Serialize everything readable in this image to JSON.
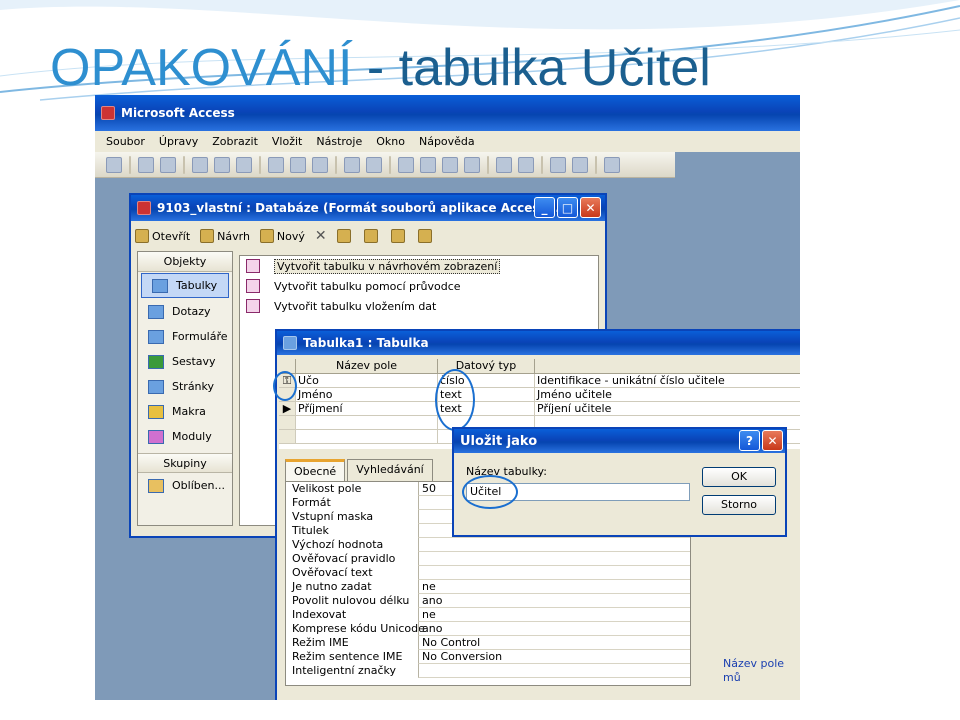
{
  "slide": {
    "title_part1": "OPAKOVÁNÍ",
    "title_part2": " - tabulka Učitel"
  },
  "access": {
    "title": "Microsoft Access",
    "menu": [
      "Soubor",
      "Úpravy",
      "Zobrazit",
      "Vložit",
      "Nástroje",
      "Okno",
      "Nápověda"
    ]
  },
  "db_window": {
    "title": "9103_vlastní : Databáze (Formát souborů aplikace Access ...",
    "toolbar": [
      "Otevřít",
      "Návrh",
      "Nový"
    ],
    "objects_header": "Objekty",
    "objects": [
      "Tabulky",
      "Dotazy",
      "Formuláře",
      "Sestavy",
      "Stránky",
      "Makra",
      "Moduly"
    ],
    "groups_header": "Skupiny",
    "groups": [
      "Oblíben..."
    ],
    "list": [
      "Vytvořit tabulku v návrhovém zobrazení",
      "Vytvořit tabulku pomocí průvodce",
      "Vytvořit tabulku vložením dat"
    ]
  },
  "table_window": {
    "title": "Tabulka1 : Tabulka",
    "columns": [
      "Název pole",
      "Datový typ"
    ],
    "rows": [
      {
        "name": "Učo",
        "type": "číslo",
        "desc": "Identifikace - unikátní číslo učitele"
      },
      {
        "name": "Jméno",
        "type": "text",
        "desc": "Jméno učitele"
      },
      {
        "name": "Příjmení",
        "type": "text",
        "desc": "Příjení učitele"
      }
    ],
    "tabs": [
      "Obecné",
      "Vyhledávání"
    ],
    "properties": [
      {
        "label": "Velikost pole",
        "value": "50"
      },
      {
        "label": "Formát",
        "value": ""
      },
      {
        "label": "Vstupní maska",
        "value": ""
      },
      {
        "label": "Titulek",
        "value": ""
      },
      {
        "label": "Výchozí hodnota",
        "value": ""
      },
      {
        "label": "Ověřovací pravidlo",
        "value": ""
      },
      {
        "label": "Ověřovací text",
        "value": ""
      },
      {
        "label": "Je nutno zadat",
        "value": "ne"
      },
      {
        "label": "Povolit nulovou délku",
        "value": "ano"
      },
      {
        "label": "Indexovat",
        "value": "ne"
      },
      {
        "label": "Komprese kódu Unicode",
        "value": "ano"
      },
      {
        "label": "Režim IME",
        "value": "No Control"
      },
      {
        "label": "Režim sentence IME",
        "value": "No Conversion"
      },
      {
        "label": "Inteligentní značky",
        "value": ""
      }
    ],
    "hint": "Název pole mů"
  },
  "save_dialog": {
    "title": "Uložit jako",
    "label": "Název tabulky:",
    "value": "Učitel",
    "ok": "OK",
    "cancel": "Storno",
    "help": "?"
  }
}
